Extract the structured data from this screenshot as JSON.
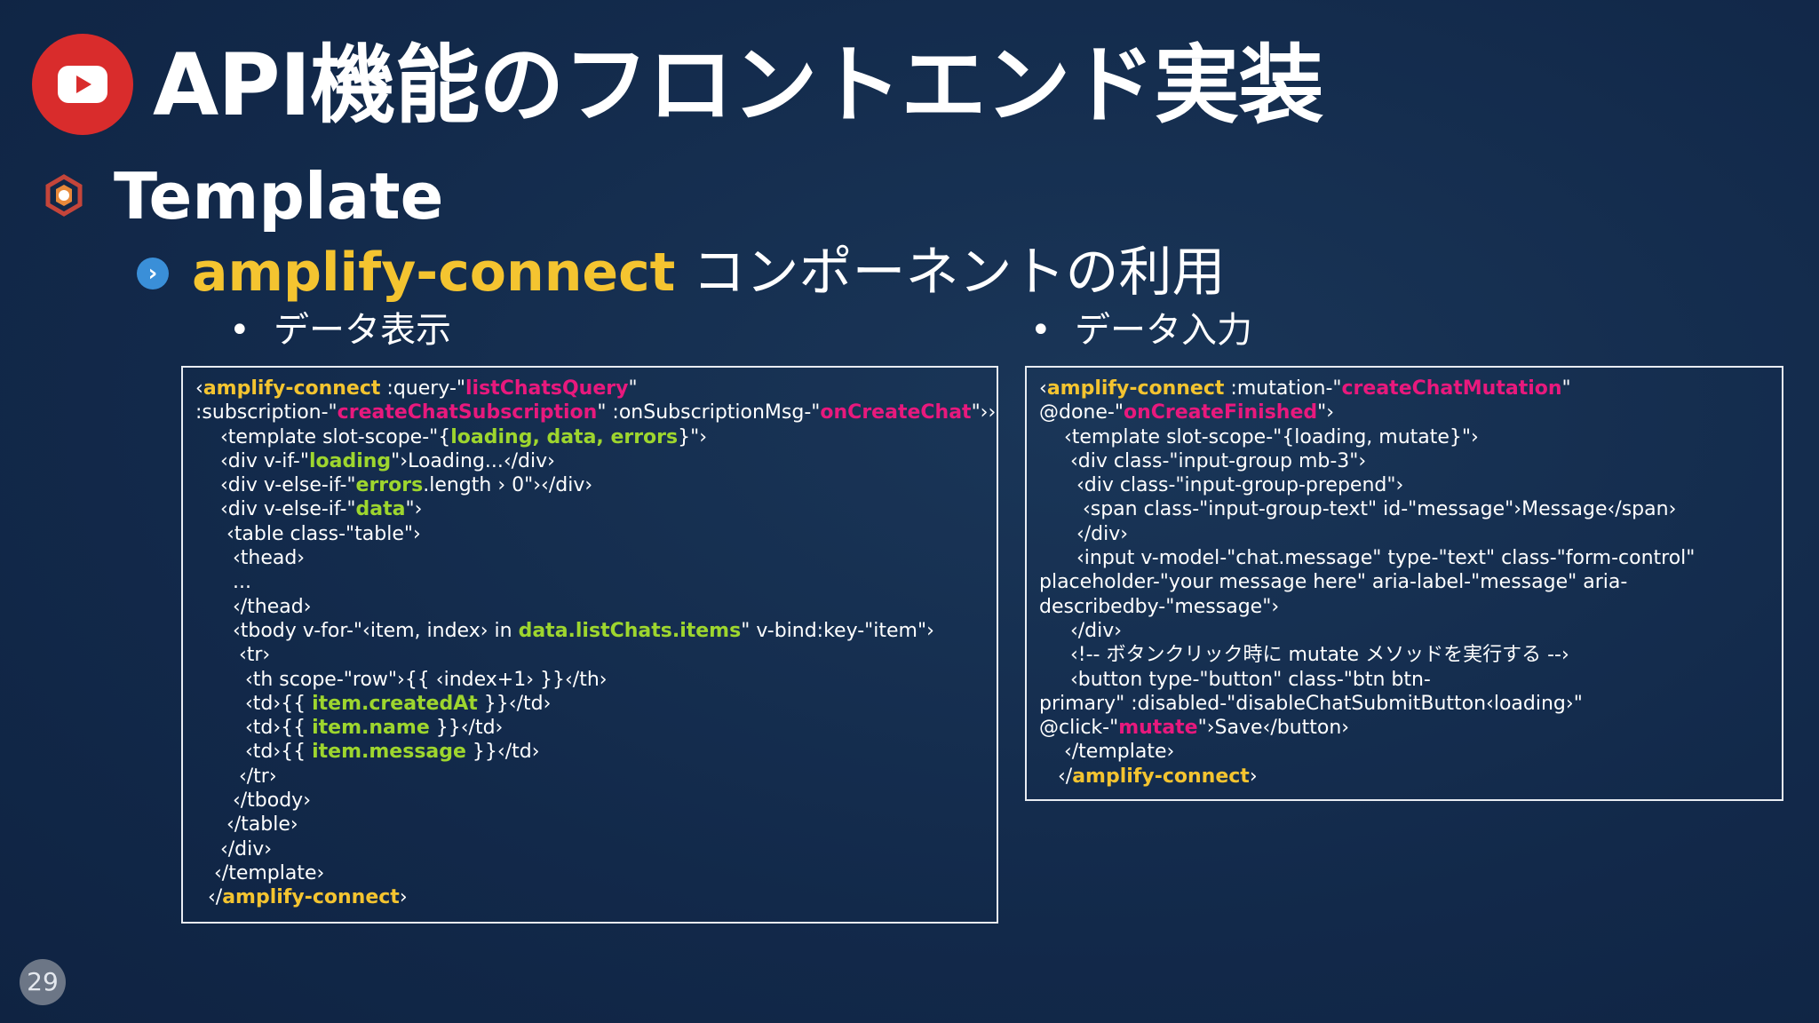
{
  "title": "API機能のフロントエンド実装",
  "heading": "Template",
  "subheading": {
    "keyword": "amplify-connect",
    "rest": " コンポーネントの利用"
  },
  "bullets": [
    {
      "marker": "•",
      "text": "データ表示"
    },
    {
      "marker": "•",
      "text": "データ入力"
    }
  ],
  "page_number": "29",
  "colors": {
    "background": "#12294a",
    "keyword": "#f4c430",
    "pink": "#e8197d",
    "green": "#9ed62e",
    "logo": "#d92c2c"
  },
  "icons": {
    "logo": "play-logo-icon",
    "heading": "hexagon-gear-icon",
    "subheading": "chevron-right-icon"
  },
  "code_left": [
    [
      [
        "‹",
        "w"
      ],
      [
        "amplify-connect",
        "y"
      ],
      [
        " :query-\"",
        "w"
      ],
      [
        "listChatsQuery",
        "p"
      ],
      [
        "\"",
        "w"
      ]
    ],
    [
      [
        ":subscription-\"",
        "w"
      ],
      [
        "createChatSubscription",
        "p"
      ],
      [
        "\" :onSubscriptionMsg-\"",
        "w"
      ],
      [
        "onCreateChat",
        "p"
      ],
      [
        "\"››",
        "w"
      ]
    ],
    [
      [
        "    ‹template slot-scope-\"{",
        "w"
      ],
      [
        "loading, data, errors",
        "g"
      ],
      [
        "}\"›",
        "w"
      ]
    ],
    [
      [
        "    ‹div v-if-\"",
        "w"
      ],
      [
        "loading",
        "g"
      ],
      [
        "\"›Loading...‹/div›",
        "w"
      ]
    ],
    [
      [
        "    ‹div v-else-if-\"",
        "w"
      ],
      [
        "errors",
        "g"
      ],
      [
        ".length › 0\"›‹/div›",
        "w"
      ]
    ],
    [
      [
        "    ‹div v-else-if-\"",
        "w"
      ],
      [
        "data",
        "g"
      ],
      [
        "\"›",
        "w"
      ]
    ],
    [
      [
        "     ‹table class-\"table\"›",
        "w"
      ]
    ],
    [
      [
        "      ‹thead›",
        "w"
      ]
    ],
    [
      [
        "      ...",
        "w"
      ]
    ],
    [
      [
        "      ‹/thead›",
        "w"
      ]
    ],
    [
      [
        "      ‹tbody v-for-\"‹item, index› in ",
        "w"
      ],
      [
        "data.listChats.items",
        "g"
      ],
      [
        "\" v-bind:key-\"item\"›",
        "w"
      ]
    ],
    [
      [
        "       ‹tr›",
        "w"
      ]
    ],
    [
      [
        "        ‹th scope-\"row\"›{{ ‹index+1› }}‹/th›",
        "w"
      ]
    ],
    [
      [
        "        ‹td›{{ ",
        "w"
      ],
      [
        "item.createdAt",
        "g"
      ],
      [
        " }}‹/td›",
        "w"
      ]
    ],
    [
      [
        "        ‹td›{{ ",
        "w"
      ],
      [
        "item.name",
        "g"
      ],
      [
        " }}‹/td›",
        "w"
      ]
    ],
    [
      [
        "        ‹td›{{ ",
        "w"
      ],
      [
        "item.message",
        "g"
      ],
      [
        " }}‹/td›",
        "w"
      ]
    ],
    [
      [
        "       ‹/tr›",
        "w"
      ]
    ],
    [
      [
        "      ‹/tbody›",
        "w"
      ]
    ],
    [
      [
        "     ‹/table›",
        "w"
      ]
    ],
    [
      [
        "    ‹/div›",
        "w"
      ]
    ],
    [
      [
        "   ‹/template›",
        "w"
      ]
    ],
    [
      [
        "  ‹/",
        "w"
      ],
      [
        "amplify-connect",
        "y"
      ],
      [
        "›",
        "w"
      ]
    ]
  ],
  "code_right": [
    [
      [
        "‹",
        "w"
      ],
      [
        "amplify-connect",
        "y"
      ],
      [
        " :mutation-\"",
        "w"
      ],
      [
        "createChatMutation",
        "p"
      ],
      [
        "\"",
        "w"
      ]
    ],
    [
      [
        "@done-\"",
        "w"
      ],
      [
        "onCreateFinished",
        "p"
      ],
      [
        "\"›",
        "w"
      ]
    ],
    [
      [
        "    ‹template slot-scope-\"{loading, mutate}\"›",
        "w"
      ]
    ],
    [
      [
        "     ‹div class-\"input-group mb-3\"›",
        "w"
      ]
    ],
    [
      [
        "      ‹div class-\"input-group-prepend\"›",
        "w"
      ]
    ],
    [
      [
        "       ‹span class-\"input-group-text\" id-\"message\"›Message‹/span›",
        "w"
      ]
    ],
    [
      [
        "      ‹/div›",
        "w"
      ]
    ],
    [
      [
        "      ‹input v-model-\"chat.message\" type-\"text\" class-\"form-control\"",
        "w"
      ]
    ],
    [
      [
        "placeholder-\"your message here\" aria-label-\"message\" aria-",
        "w"
      ]
    ],
    [
      [
        "describedby-\"message\"›",
        "w"
      ]
    ],
    [
      [
        "     ‹/div›",
        "w"
      ]
    ],
    [
      [
        "     ‹!-- ボタンクリック時に mutate メソッドを実行する --›",
        "w"
      ]
    ],
    [
      [
        "     ‹button type-\"button\" class-\"btn btn-",
        "w"
      ]
    ],
    [
      [
        "primary\" :disabled-\"disableChatSubmitButton‹loading›\"",
        "w"
      ]
    ],
    [
      [
        "@click-\"",
        "w"
      ],
      [
        "mutate",
        "p"
      ],
      [
        "\"›Save‹/button›",
        "w"
      ]
    ],
    [
      [
        "    ‹/template›",
        "w"
      ]
    ],
    [
      [
        "   ‹/",
        "w"
      ],
      [
        "amplify-connect",
        "y"
      ],
      [
        "›",
        "w"
      ]
    ]
  ]
}
